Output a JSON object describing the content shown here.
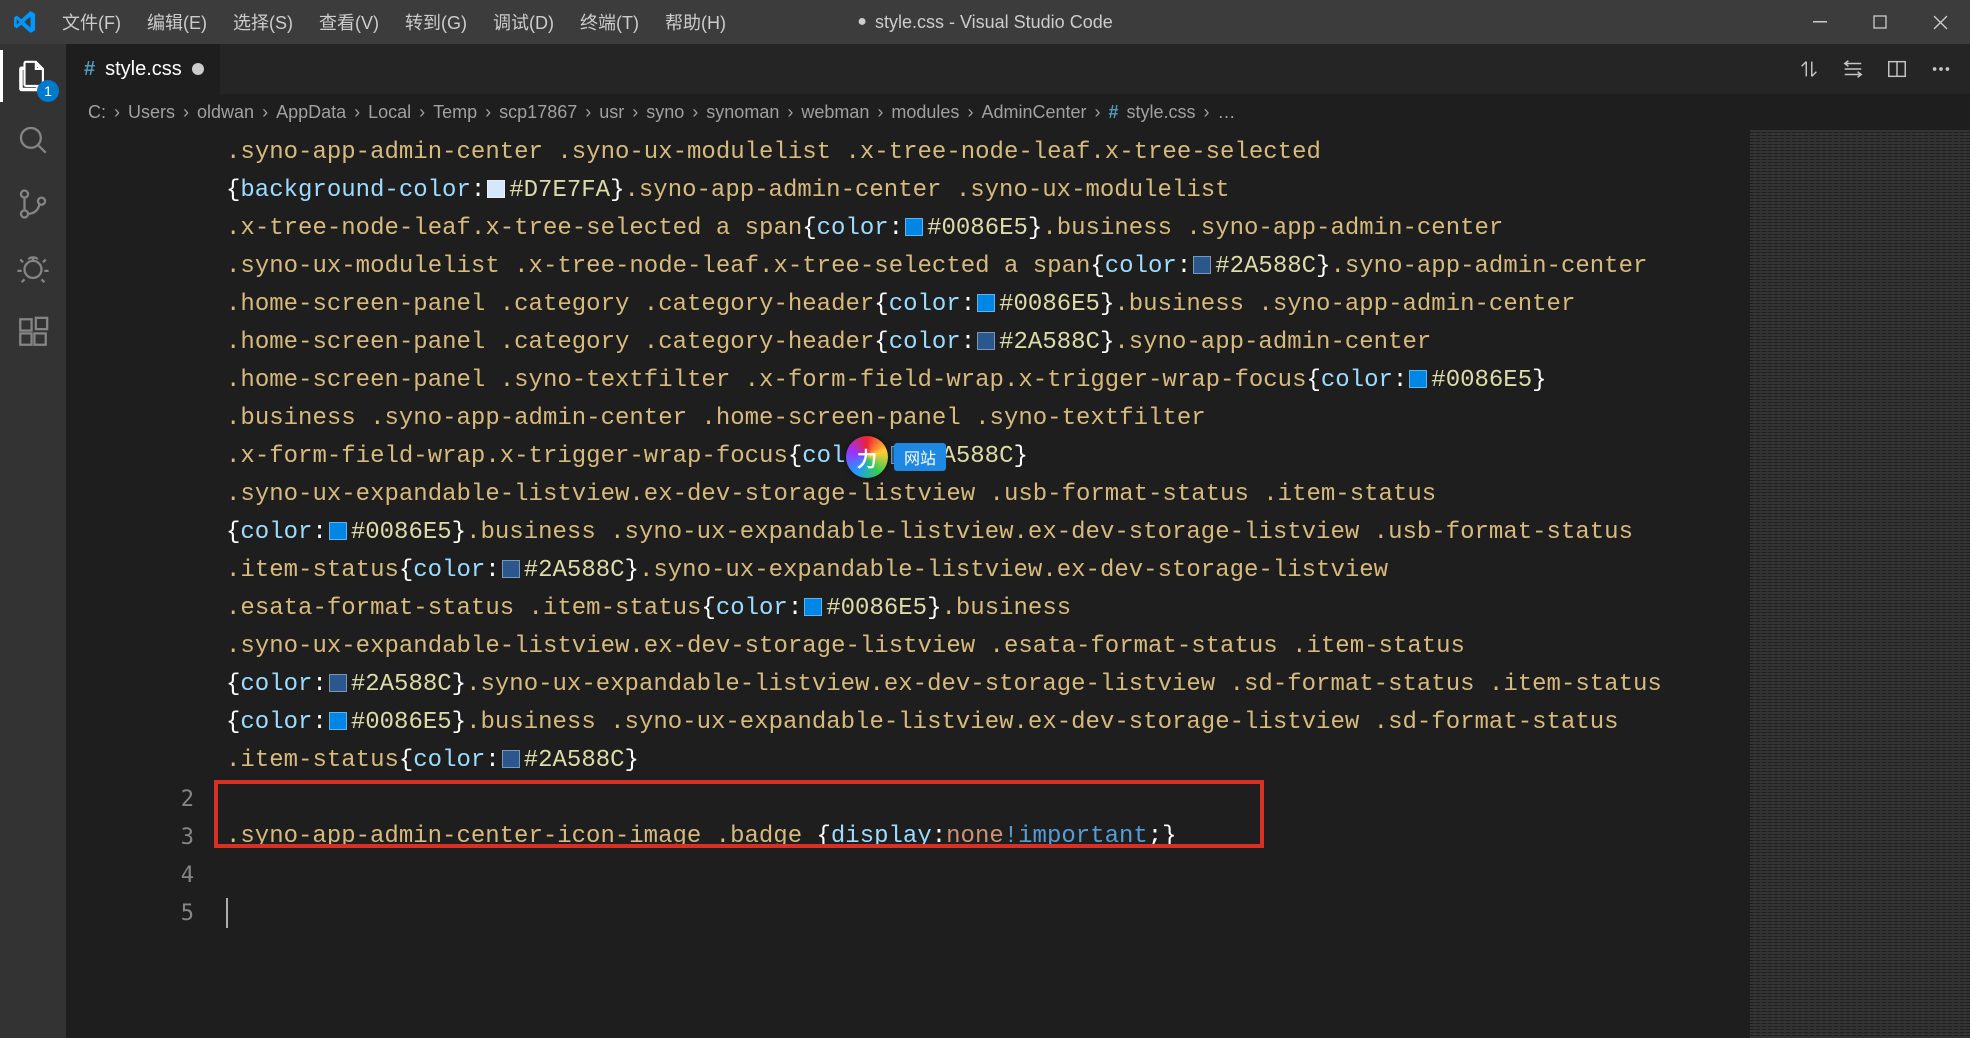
{
  "menubar": {
    "file": "文件(F)",
    "edit": "编辑(E)",
    "select": "选择(S)",
    "view": "查看(V)",
    "goto": "转到(G)",
    "debug": "调试(D)",
    "terminal": "终端(T)",
    "help": "帮助(H)"
  },
  "window_title": {
    "dirty_dot": "●",
    "text": "style.css - Visual Studio Code"
  },
  "activitybar": {
    "explorer_badge": "1"
  },
  "tab": {
    "icon": "#",
    "filename": "style.css"
  },
  "breadcrumb": {
    "parts": [
      "C:",
      "Users",
      "oldwan",
      "AppData",
      "Local",
      "Temp",
      "scp17867",
      "usr",
      "syno",
      "synoman",
      "webman",
      "modules",
      "AdminCenter"
    ],
    "file_icon": "#",
    "file": "style.css",
    "ellipsis": "…"
  },
  "colors": {
    "D7E7FA": "#D7E7FA",
    "c0086E5": "#0086E5",
    "c2A588C": "#2A588C"
  },
  "code_block1": [
    ".syno-app-admin-center .syno-ux-modulelist .x-tree-node-leaf.x-tree-selected",
    "{background-color:◼#D7E7FA}.syno-app-admin-center .syno-ux-modulelist",
    ".x-tree-node-leaf.x-tree-selected a span{color:◼#0086E5}.business .syno-app-admin-center",
    ".syno-ux-modulelist .x-tree-node-leaf.x-tree-selected a span{color:◼#2A588C}.syno-app-admin-center",
    ".home-screen-panel .category .category-header{color:◼#0086E5}.business .syno-app-admin-center",
    ".home-screen-panel .category .category-header{color:◼#2A588C}.syno-app-admin-center",
    ".home-screen-panel .syno-textfilter .x-form-field-wrap.x-trigger-wrap-focus{color:◼#0086E5}",
    ".business .syno-app-admin-center .home-screen-panel .syno-textfilter",
    ".x-form-field-wrap.x-trigger-wrap-focus{color:◼#2A588C}",
    ".syno-ux-expandable-listview.ex-dev-storage-listview .usb-format-status .item-status",
    "{color:◼#0086E5}.business .syno-ux-expandable-listview.ex-dev-storage-listview .usb-format-status",
    ".item-status{color:◼#2A588C}.syno-ux-expandable-listview.ex-dev-storage-listview",
    ".esata-format-status .item-status{color:◼#0086E5}.business",
    ".syno-ux-expandable-listview.ex-dev-storage-listview .esata-format-status .item-status",
    "{color:◼#2A588C}.syno-ux-expandable-listview.ex-dev-storage-listview .sd-format-status .item-status",
    "{color:◼#0086E5}.business .syno-ux-expandable-listview.ex-dev-storage-listview .sd-format-status",
    ".item-status{color:◼#2A588C}"
  ],
  "line_numbers": [
    "2",
    "3",
    "4",
    "5"
  ],
  "line3": {
    "selector": ".syno-app-admin-center-icon-image .badge ",
    "brace_open": "{",
    "prop": "display",
    "colon": ":",
    "value": "none",
    "imp": "!important",
    "semi_brace": ";}"
  },
  "watermark": {
    "circle": "力",
    "badge": "网站"
  }
}
